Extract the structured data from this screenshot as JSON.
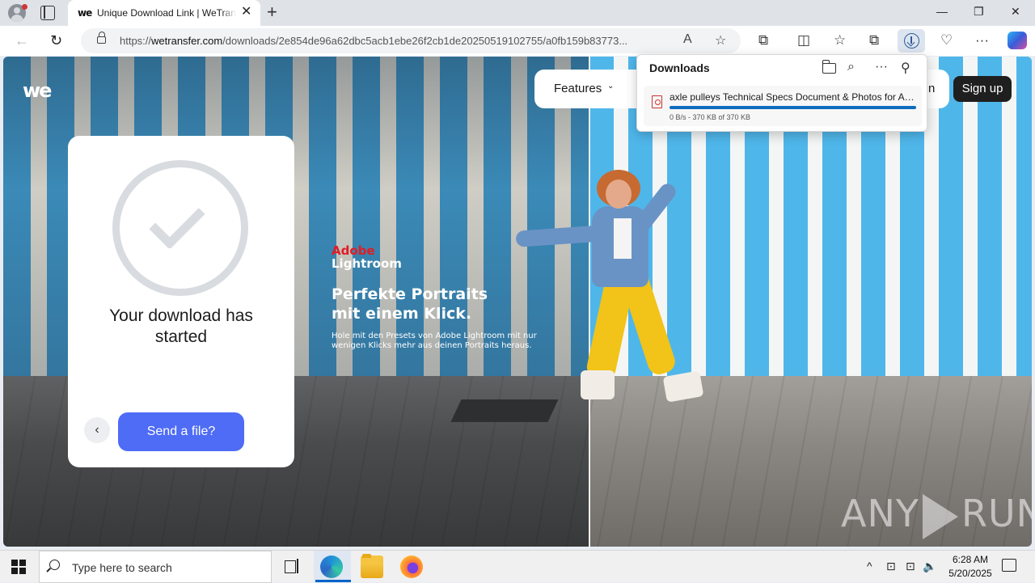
{
  "browser": {
    "tab": {
      "favicon_text": "we",
      "title": "Unique Download Link | WeTransfer",
      "close_glyph": "✕"
    },
    "new_tab_glyph": "+",
    "window_controls": {
      "minimize": "—",
      "restore": "❐",
      "close": "✕"
    },
    "nav": {
      "back": "←",
      "refresh": "↻"
    },
    "address": {
      "prefix": "https://",
      "domain": "wetransfer.com",
      "path": "/downloads/2e854de96a62dbc5acb1ebe26f2cb1de20250519102755/a0fb159b83773..."
    },
    "toolbar_glyphs": {
      "read_aloud": "A",
      "favorite": "☆",
      "extensions": "⧉",
      "split_screen": "◫",
      "favorites_list": "☆",
      "collections": "⧉",
      "browser_essentials": "♡",
      "more": "···"
    }
  },
  "page": {
    "logo": "we",
    "nav": {
      "features": "Features",
      "features_chevron": "⌄",
      "login_fragment": "n",
      "signup": "Sign up"
    },
    "card": {
      "title": "Your download has started",
      "back_glyph": "‹",
      "send_button": "Send a file?"
    },
    "ad": {
      "brand_top": "Adobe",
      "brand_bottom": "Lightroom",
      "headline": "Perfekte Portraits\nmit einem Klick.",
      "body": "Hole mit den Presets von Adobe Lightroom mit nur wenigen Klicks mehr aus deinen Portraits heraus."
    },
    "watermark": {
      "left": "ANY",
      "right": "RUN"
    }
  },
  "downloads_panel": {
    "title": "Downloads",
    "glyphs": {
      "search": "⌕",
      "more": "···",
      "pin": "⚲"
    },
    "item": {
      "name": "axle pulleys Technical Specs Document & Photos for AR...",
      "status": "0 B/s - 370 KB of 370 KB",
      "progress": 1.0
    }
  },
  "taskbar": {
    "search_placeholder": "Type here to search",
    "tray_glyphs": {
      "chevron": "^",
      "network": "⊡",
      "volume": "🔈"
    },
    "time": "6:28 AM",
    "date": "5/20/2025"
  },
  "colors": {
    "accent_blue": "#4e6cf5",
    "signup_bg": "#1f1f1f",
    "adobe_red": "#e31b23",
    "download_progress": "#0f6cbd"
  }
}
